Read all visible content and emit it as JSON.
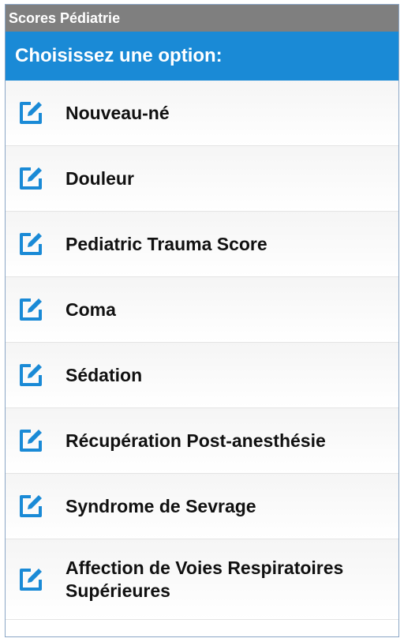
{
  "app": {
    "title": "Scores Pédiatrie"
  },
  "header": {
    "prompt": "Choisissez une option:"
  },
  "colors": {
    "titlebar": "#7f7f7f",
    "header": "#1a8ad6",
    "icon": "#1a8ad6"
  },
  "menu": {
    "icon_name": "edit-icon",
    "items": [
      {
        "label": "Nouveau-né"
      },
      {
        "label": "Douleur"
      },
      {
        "label": "Pediatric Trauma Score"
      },
      {
        "label": "Coma"
      },
      {
        "label": "Sédation"
      },
      {
        "label": "Récupération Post-anesthésie"
      },
      {
        "label": "Syndrome de Sevrage"
      },
      {
        "label": "Affection de Voies Respiratoires Supérieures"
      }
    ]
  }
}
